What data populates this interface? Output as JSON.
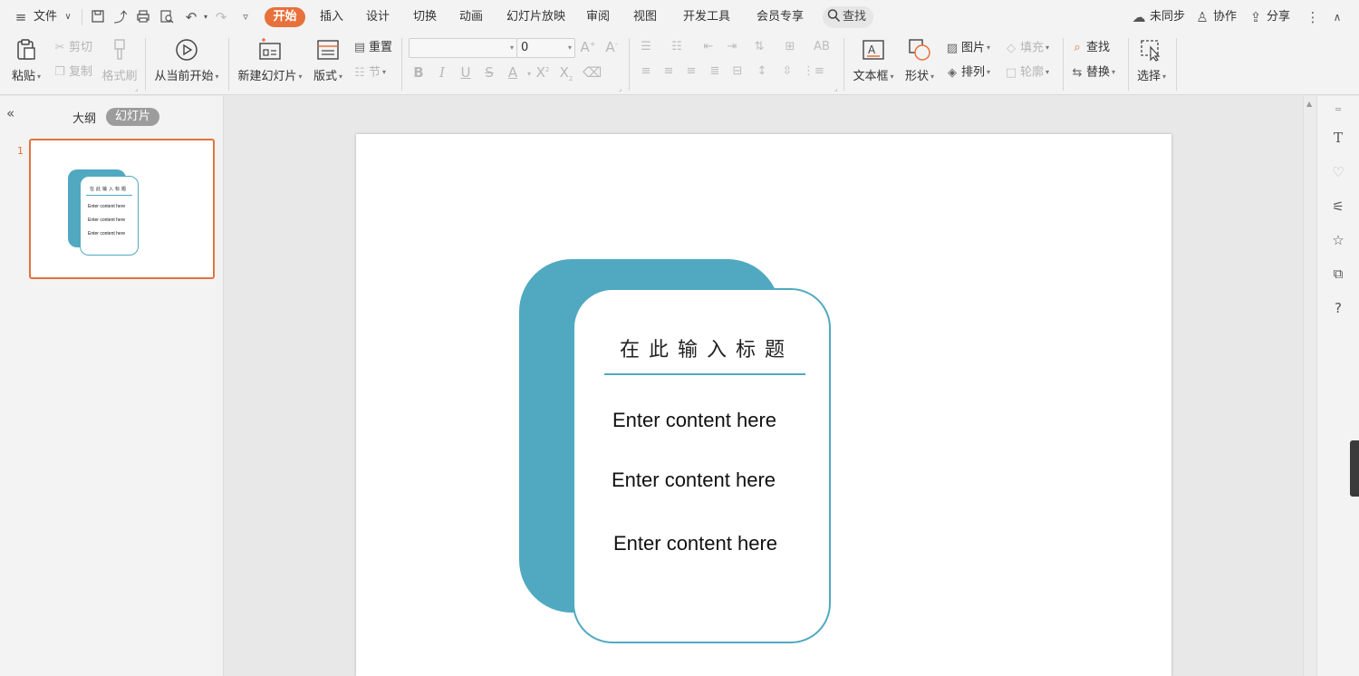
{
  "menu": {
    "file": "文件",
    "tabs": [
      "开始",
      "插入",
      "设计",
      "切换",
      "动画",
      "幻灯片放映",
      "审阅",
      "视图",
      "开发工具",
      "会员专享"
    ],
    "search": "查找",
    "sync": "未同步",
    "collab": "协作",
    "share": "分享",
    "accent_color": "#e8703a"
  },
  "ribbon": {
    "paste": "粘贴",
    "cut": "剪切",
    "copy": "复制",
    "format_painter": "格式刷",
    "from_current": "从当前开始",
    "new_slide": "新建幻灯片",
    "layout": "版式",
    "reset": "重置",
    "section": "节",
    "font_size": "0",
    "textbox": "文本框",
    "shape": "形状",
    "picture": "图片",
    "fill": "填充",
    "arrange": "排列",
    "outline": "轮廓",
    "find": "查找",
    "replace": "替换",
    "select": "选择"
  },
  "panel": {
    "outline_tab": "大纲",
    "slides_tab": "幻灯片",
    "slide_number": "1"
  },
  "slide": {
    "title": "在此输入标题",
    "items": [
      "Enter content here",
      "Enter content here",
      "Enter content here"
    ],
    "card_color": "#50a9c0"
  }
}
